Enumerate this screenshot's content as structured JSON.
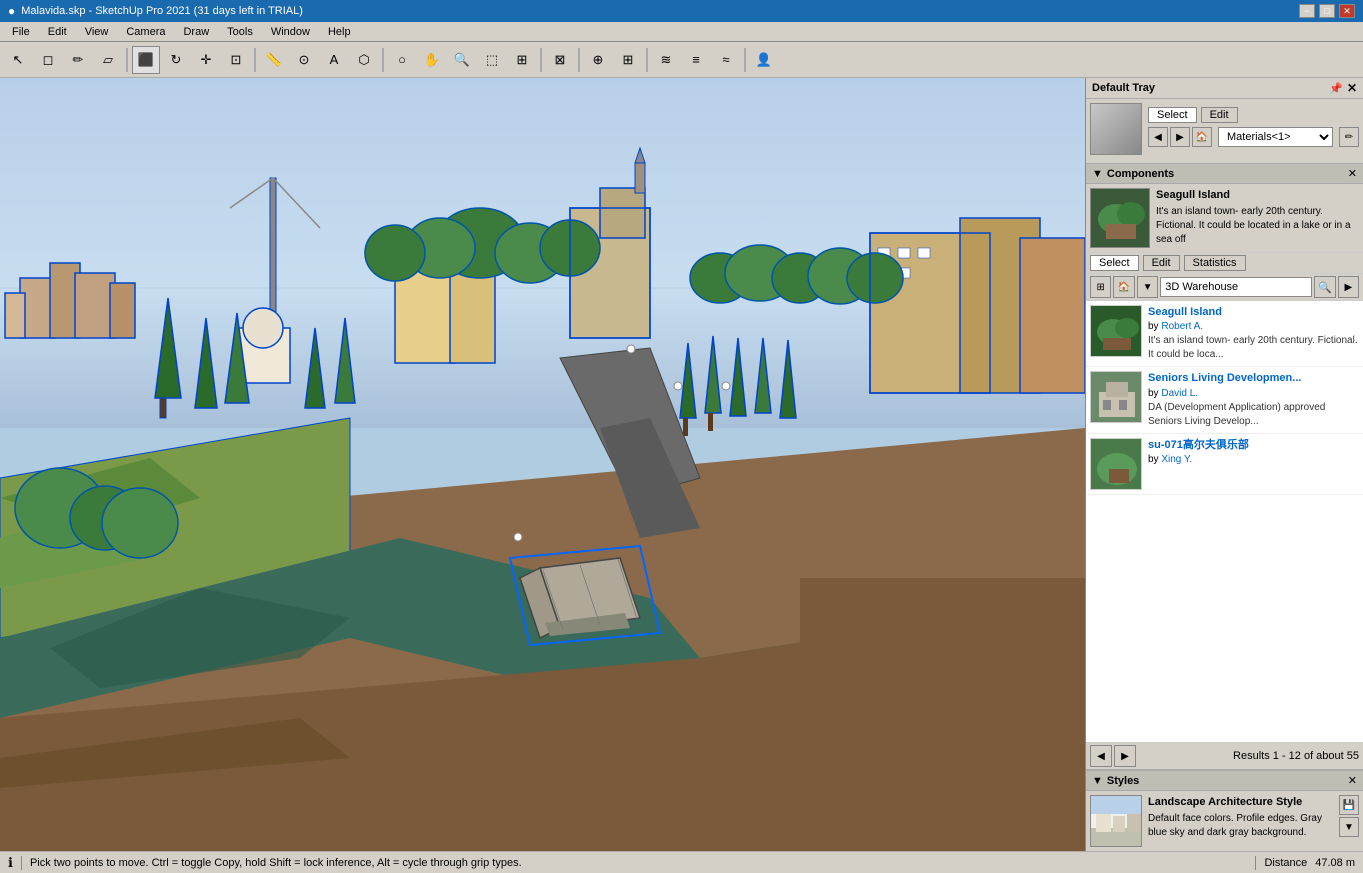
{
  "titlebar": {
    "title": "Malavida.skp - SketchUp Pro 2021 (31 days left in TRIAL)",
    "icon": "●",
    "minimize": "−",
    "maximize": "□",
    "close": "✕"
  },
  "menubar": {
    "items": [
      "File",
      "Edit",
      "View",
      "Camera",
      "Draw",
      "Tools",
      "Window",
      "Help"
    ]
  },
  "toolbar": {
    "tools": [
      {
        "name": "select",
        "icon": "↖"
      },
      {
        "name": "eraser",
        "icon": "◻"
      },
      {
        "name": "pencil",
        "icon": "✏"
      },
      {
        "name": "shape",
        "icon": "▱"
      },
      {
        "name": "push-pull",
        "icon": "⬛"
      },
      {
        "name": "rotate",
        "icon": "↻"
      },
      {
        "name": "move",
        "icon": "✛"
      },
      {
        "name": "tape",
        "icon": "📏"
      },
      {
        "name": "offset",
        "icon": "⊡"
      },
      {
        "name": "text",
        "icon": "A"
      },
      {
        "name": "paint",
        "icon": "⬡"
      },
      {
        "name": "camera-orbit",
        "icon": "○"
      },
      {
        "name": "camera-pan",
        "icon": "✋"
      },
      {
        "name": "camera-zoom",
        "icon": "🔍"
      },
      {
        "name": "zoom-window",
        "icon": "⬚"
      },
      {
        "name": "zoom-extents",
        "icon": "⊞"
      },
      {
        "name": "section-plane",
        "icon": "⊠"
      },
      {
        "name": "walk",
        "icon": "⊙"
      },
      {
        "name": "components",
        "icon": "⊞"
      },
      {
        "name": "fog",
        "icon": "≋"
      },
      {
        "name": "layers",
        "icon": "≡"
      },
      {
        "name": "match-photo",
        "icon": "≈"
      },
      {
        "name": "person",
        "icon": "👤"
      }
    ]
  },
  "right_panel": {
    "tray_title": "Default Tray",
    "material": {
      "select_label": "Select",
      "edit_label": "Edit",
      "dropdown_value": "Materials<1>",
      "preview_colors": [
        "#c0c0c0",
        "#a0a0a0"
      ]
    },
    "components": {
      "title": "Components",
      "current": {
        "name": "Seagull Island",
        "description": "It's an island town- early 20th century. Fictional. It could be located in a lake or in a sea off"
      },
      "tabs": [
        "Select",
        "Edit",
        "Statistics"
      ],
      "select_tab_active": true,
      "search_placeholder": "3D Warehouse",
      "results": [
        {
          "title": "Seagull Island",
          "author": "Robert A.",
          "description": "It's an island town- early 20th century. Fictional. It could be loca...",
          "thumb_color": "#5a8a5a"
        },
        {
          "title": "Seniors Living Developmen...",
          "author": "David L.",
          "description": "DA (Development Application) approved Seniors Living Develop...",
          "thumb_color": "#8a6a4a"
        },
        {
          "title": "su-071高尔夫俱乐部",
          "author": "Xing Y.",
          "description": "",
          "thumb_color": "#6a8a6a"
        }
      ],
      "results_text": "Results 1 - 12 of about 55"
    },
    "styles": {
      "title": "Styles",
      "current_name": "Landscape Architecture Style",
      "description": "Default face colors. Profile edges. Gray blue sky and dark gray background."
    }
  },
  "statusbar": {
    "info_icon": "ℹ",
    "status_text": "Pick two points to move.  Ctrl = toggle Copy, hold Shift = lock inference, Alt = cycle through grip types.",
    "distance_label": "Distance",
    "distance_value": "47.08 m"
  }
}
